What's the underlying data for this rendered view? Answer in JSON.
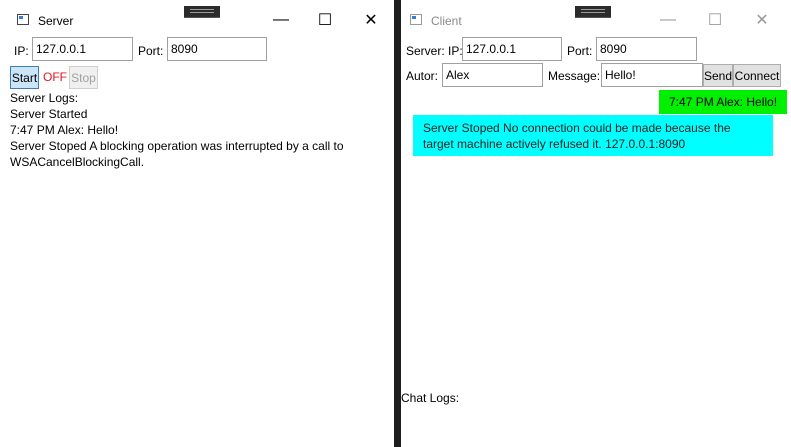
{
  "server": {
    "title": "Server",
    "ip_label": "IP:",
    "ip_value": "127.0.0.1",
    "port_label": "Port:",
    "port_value": "8090",
    "start_label": "Start",
    "status_text": "OFF",
    "stop_label": "Stop",
    "logs_header": "Server Logs:",
    "logs": [
      "Server Started",
      "7:47 PM Alex: Hello!",
      "Server Stoped A blocking operation was interrupted by a call to",
      "WSACancelBlockingCall."
    ],
    "controls": {
      "minimize": "—",
      "maximize": "☐",
      "close": "✕"
    }
  },
  "client": {
    "title": "Client",
    "ip_label": "Server: IP:",
    "ip_value": "127.0.0.1",
    "port_label": "Port:",
    "port_value": "8090",
    "author_label": "Autor:",
    "author_value": "Alex",
    "message_label": "Message:",
    "message_value": "Hello!",
    "send_label": "Send",
    "connect_label": "Connect",
    "sent_message": "7:47 PM Alex: Hello!",
    "error_message": "Server Stoped No connection could be made because the target machine actively refused it. 127.0.0.1:8090",
    "chat_logs_label": "Chat Logs:",
    "controls": {
      "minimize": "—",
      "maximize": "☐",
      "close": "✕"
    }
  },
  "colors": {
    "status_off": "#e81123",
    "sent_bubble": "#00f000",
    "error_bubble": "#00ffff"
  }
}
